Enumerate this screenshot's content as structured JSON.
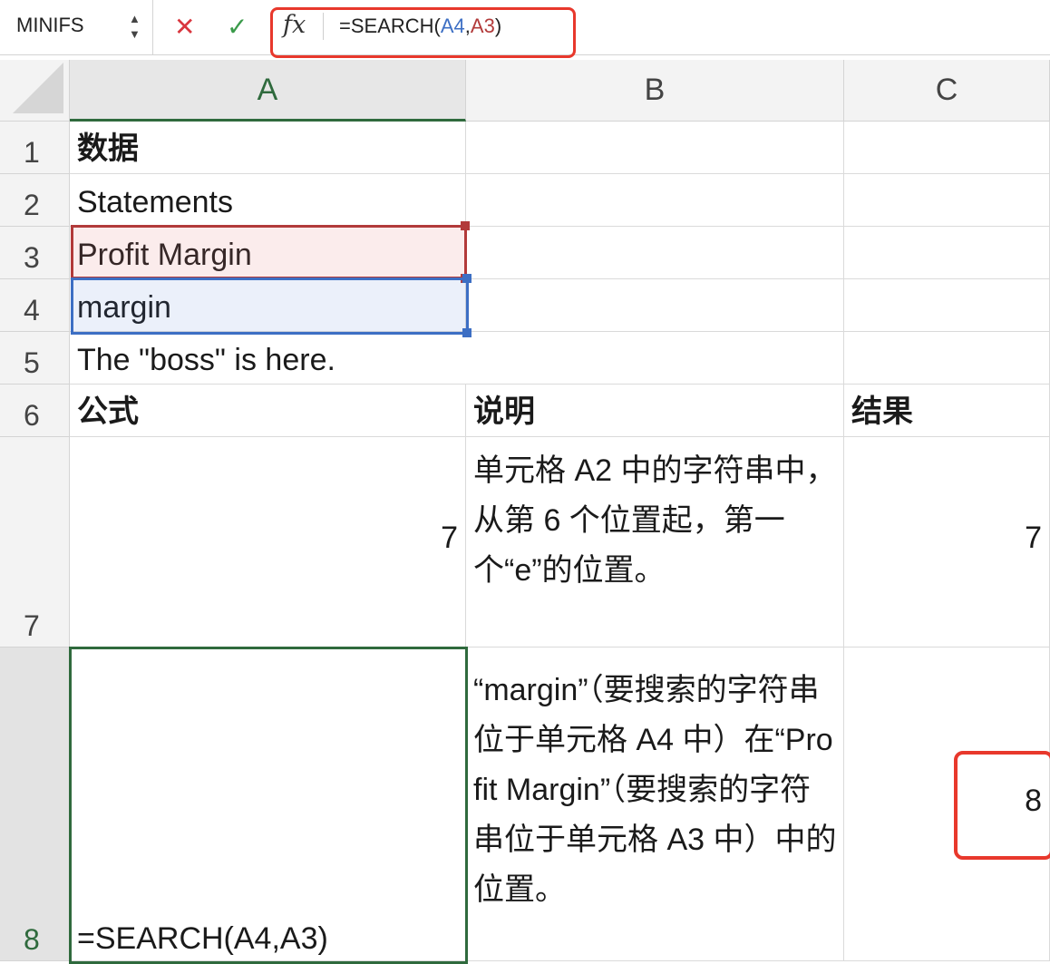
{
  "formula_bar": {
    "name_box": "MINIFS",
    "name_box_arrows": "▲\n▼",
    "cancel_icon": "✕",
    "enter_icon": "✓",
    "fx_label": "fx",
    "formula_prefix": "=SEARCH(",
    "formula_ref1": "A4",
    "formula_comma": ",",
    "formula_ref2": "A3",
    "formula_suffix": ")"
  },
  "columns": [
    "A",
    "B",
    "C"
  ],
  "rows": [
    "1",
    "2",
    "3",
    "4",
    "5",
    "6",
    "7",
    "8"
  ],
  "cells": {
    "A1": "数据",
    "A2": "Statements",
    "A3": "Profit Margin",
    "A4": "margin",
    "A5": "The \"boss\" is here.",
    "A6": "公式",
    "B6": "说明",
    "C6": "结果",
    "A7": "7",
    "B7": "单元格 A2 中的字符串中，从第 6 个位置起，第一个“e”的位置。",
    "C7": "7",
    "A8": "=SEARCH(A4,A3)",
    "B8": "“margin”（要搜索的字符串位于单元格 A4 中）在“Profit Margin”（要搜索的字符串位于单元格 A3 中）中的位置。",
    "C8": "8"
  },
  "colors": {
    "active_green": "#2f6a3d",
    "ref_blue": "#3d6fc4",
    "ref_red": "#b23a3a",
    "highlight_red": "#e8382c"
  }
}
